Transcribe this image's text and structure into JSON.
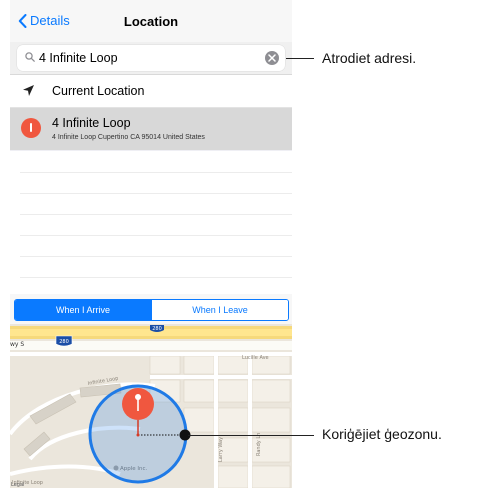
{
  "nav": {
    "back_label": "Details",
    "title": "Location"
  },
  "search": {
    "value": "4 Infinite Loop"
  },
  "results": {
    "current_label": "Current Location",
    "item_title": "4 Infinite Loop",
    "item_subtitle": "4 Infinite Loop Cupertino CA 95014 United States"
  },
  "segment": {
    "arrive_label": "When I Arrive",
    "leave_label": "When I Leave"
  },
  "map": {
    "highway_shield": "280",
    "highway_shield_2": "280",
    "road_wy": "wy S",
    "street_lucille": "Lucille Ave",
    "street_infinite": "Infinite Loop",
    "street_infinite_2": "Infinite Loop",
    "street_larry": "Larry Way",
    "street_randy": "Randy Ln",
    "poi_apple": "Apple Inc.",
    "legal": "Legal"
  },
  "callouts": {
    "address_label": "Atrodiet adresi.",
    "geofence_label": "Koriģējiet ģeozonu."
  },
  "colors": {
    "accent": "#0a7aff",
    "pin": "#f0573f",
    "geofence": "#1f7ae6"
  }
}
